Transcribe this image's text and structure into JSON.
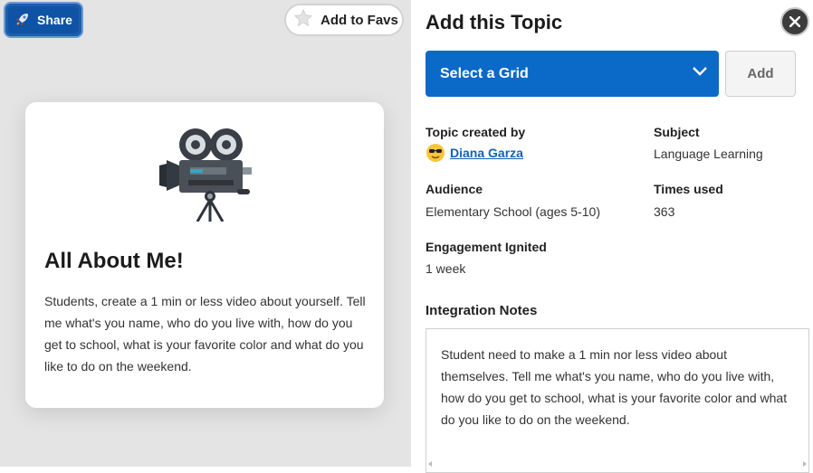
{
  "left": {
    "share_label": "Share",
    "favs_label": "Add to Favs",
    "card": {
      "title": "All About Me!",
      "description": "Students, create a 1 min or less video about yourself. Tell me what's you name, who do you live with, how do you get to school, what is your favorite color and what do you like to do on the weekend."
    }
  },
  "panel": {
    "title": "Add this Topic",
    "select_label": "Select a Grid",
    "add_label": "Add",
    "creator_label": "Topic created by",
    "creator_name": "Diana Garza",
    "subject_label": "Subject",
    "subject_value": "Language Learning",
    "audience_label": "Audience",
    "audience_value": "Elementary School (ages 5-10)",
    "times_label": "Times used",
    "times_value": "363",
    "engagement_label": "Engagement Ignited",
    "engagement_value": "1 week",
    "notes_label": "Integration Notes",
    "notes_text": "Student need to make a 1 min nor less video about themselves. Tell me what's you name, who do you live with, how do you get to school, what is your favorite color and what do you like to do on the weekend."
  },
  "colors": {
    "primary": "#0b69c8",
    "link": "#1561b8",
    "share_bg": "#0f53a4"
  },
  "icons": [
    "rocket-icon",
    "star-icon",
    "video-camera-icon",
    "close-icon",
    "chevron-down-icon",
    "sunglasses-emoji-icon"
  ]
}
